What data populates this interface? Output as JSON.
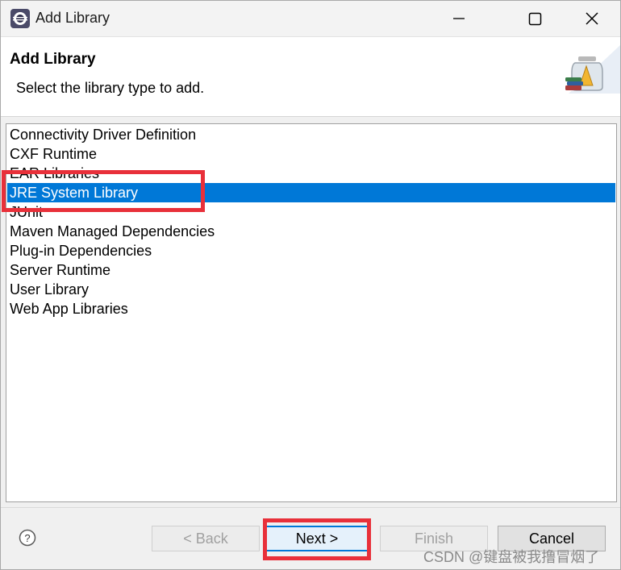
{
  "window": {
    "title": "Add Library",
    "minimize_icon": "minimize-icon",
    "maximize_icon": "maximize-icon",
    "close_icon": "close-icon"
  },
  "header": {
    "title": "Add Library",
    "description": "Select the library type to add."
  },
  "libraries": [
    {
      "label": "Connectivity Driver Definition",
      "selected": false
    },
    {
      "label": "CXF Runtime",
      "selected": false
    },
    {
      "label": "EAR Libraries",
      "selected": false
    },
    {
      "label": "JRE System Library",
      "selected": true
    },
    {
      "label": "JUnit",
      "selected": false
    },
    {
      "label": "Maven Managed Dependencies",
      "selected": false
    },
    {
      "label": "Plug-in Dependencies",
      "selected": false
    },
    {
      "label": "Server Runtime",
      "selected": false
    },
    {
      "label": "User Library",
      "selected": false
    },
    {
      "label": "Web App Libraries",
      "selected": false
    }
  ],
  "buttons": {
    "back": "< Back",
    "next": "Next >",
    "finish": "Finish",
    "cancel": "Cancel"
  },
  "watermark": "CSDN @键盘被我撸冒烟了",
  "colors": {
    "selection": "#0078d7",
    "annotation": "#e8303a"
  }
}
